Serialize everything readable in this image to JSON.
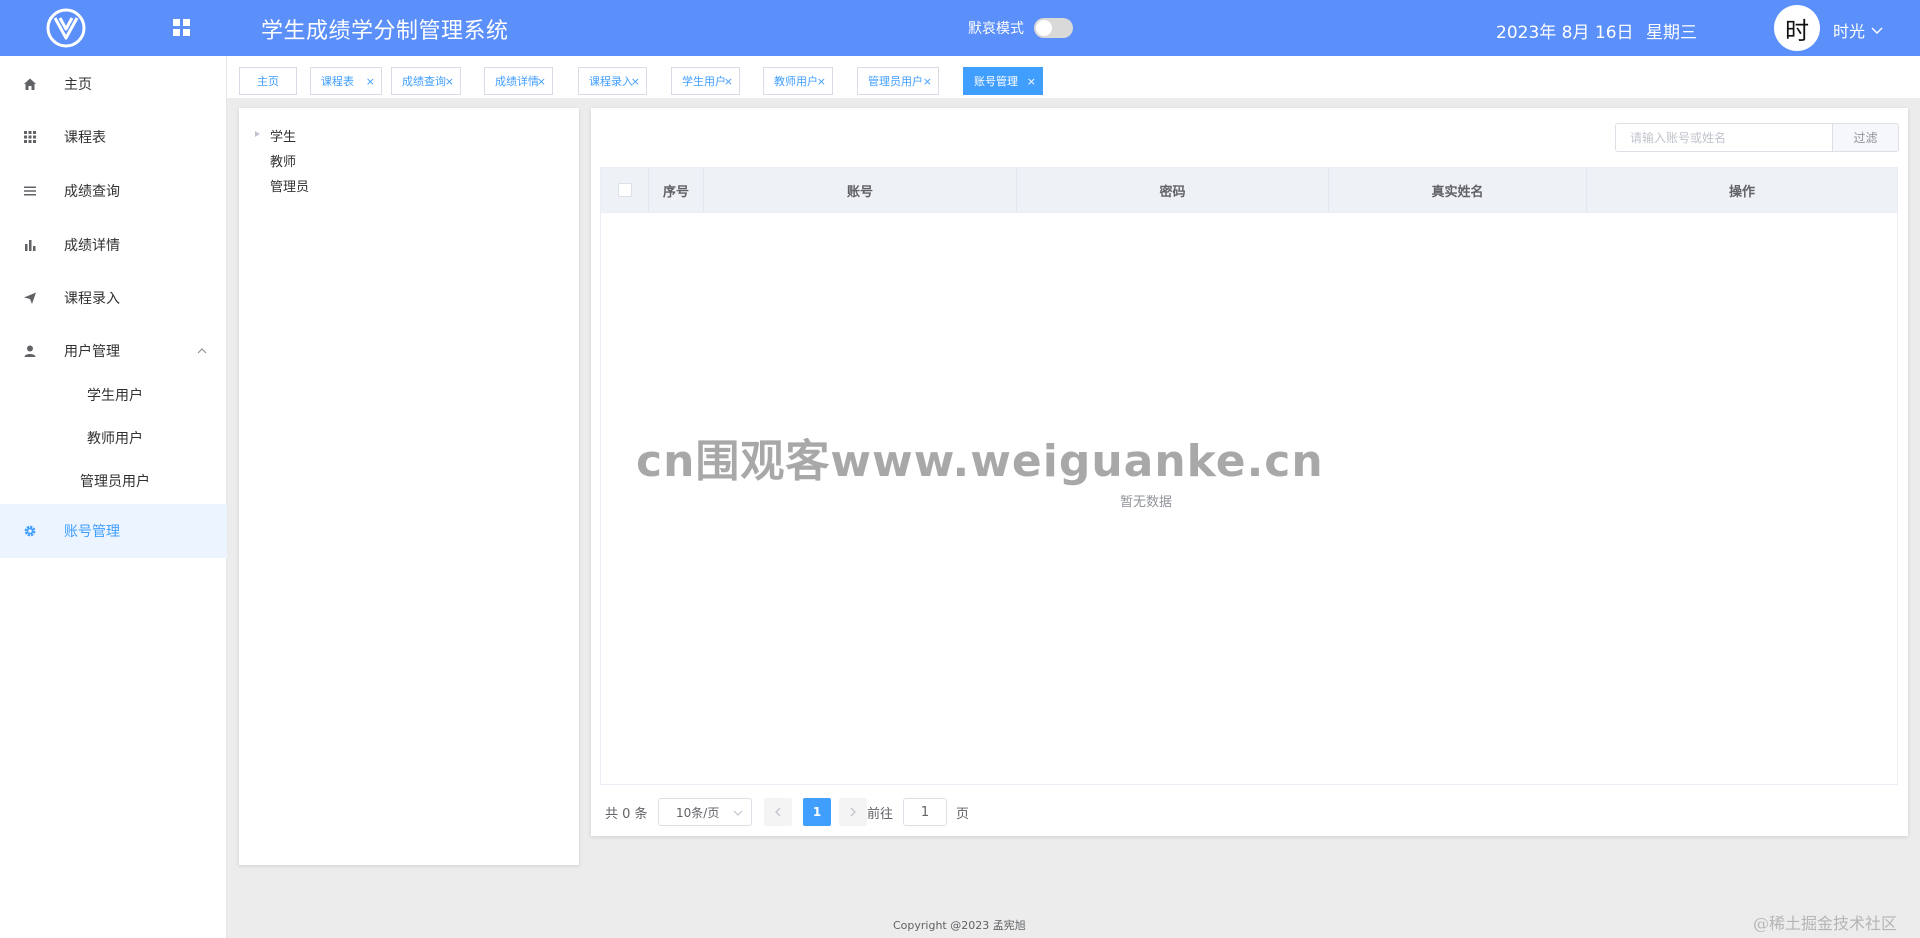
{
  "header": {
    "title": "学生成绩学分制管理系统",
    "silent_mode_label": "默哀模式",
    "date": "2023年 8月 16日",
    "weekday": "星期三",
    "avatar_char": "时",
    "user_name": "时光",
    "brand_color": "#5b8ff9"
  },
  "sidebar": {
    "items": [
      {
        "label": "主页",
        "icon": "home-icon"
      },
      {
        "label": "课程表",
        "icon": "grid-icon"
      },
      {
        "label": "成绩查询",
        "icon": "list-icon"
      },
      {
        "label": "成绩详情",
        "icon": "bar-chart-icon"
      },
      {
        "label": "课程录入",
        "icon": "send-icon"
      },
      {
        "label": "用户管理",
        "icon": "user-icon"
      },
      {
        "label": "账号管理",
        "icon": "gear-icon"
      }
    ],
    "sub_items": [
      "学生用户",
      "教师用户",
      "管理员用户"
    ],
    "active_color": "#409eff"
  },
  "tabs": [
    {
      "label": "主页",
      "closable": false
    },
    {
      "label": "课程表",
      "closable": true
    },
    {
      "label": "成绩查询",
      "closable": true
    },
    {
      "label": "成绩详情",
      "closable": true
    },
    {
      "label": "课程录入",
      "closable": true
    },
    {
      "label": "学生用户",
      "closable": true
    },
    {
      "label": "教师用户",
      "closable": true
    },
    {
      "label": "管理员用户",
      "closable": true
    },
    {
      "label": "账号管理",
      "closable": true,
      "active": true
    }
  ],
  "tab_close_glyph": "×",
  "tree": [
    "学生",
    "教师",
    "管理员"
  ],
  "filter": {
    "placeholder": "请输入账号或姓名",
    "button": "过滤"
  },
  "table": {
    "columns": [
      "序号",
      "账号",
      "密码",
      "真实姓名",
      "操作"
    ],
    "rows": [],
    "empty_text": "暂无数据"
  },
  "pagination": {
    "total": "共 0 条",
    "page_size": "10条/页",
    "current_page": "1",
    "goto_label": "前往",
    "goto_value": "1",
    "page_unit": "页"
  },
  "watermark": "cn围观客www.weiguanke.cn",
  "footer": {
    "copyright": "Copyright @2023 孟宪旭",
    "corner_mark": "@稀土掘金技术社区"
  }
}
